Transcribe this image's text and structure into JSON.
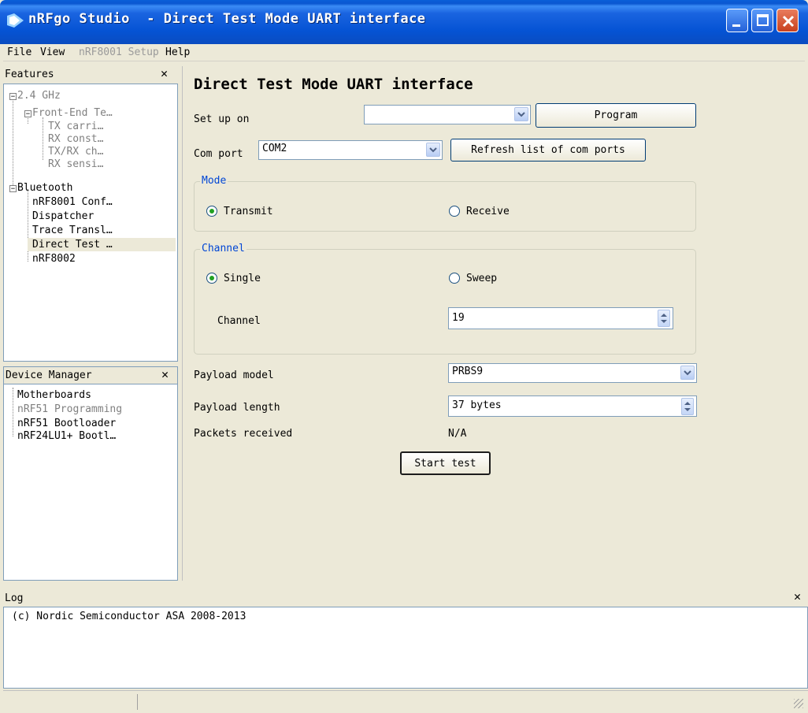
{
  "window": {
    "title": "nRFgo Studio  - Direct Test Mode UART interface"
  },
  "menu": [
    "File",
    "View",
    "nRF8001 Setup",
    "Help"
  ],
  "features_panel": {
    "title": "Features",
    "items": {
      "ghz": "2.4 GHz",
      "frontend": "Front-End Te…",
      "tx_carrier": "TX carri…",
      "rx_const": "RX const…",
      "txrx_ch": "TX/RX ch…",
      "rx_sensi": "RX sensi…",
      "bluetooth": "Bluetooth",
      "nrf8001_conf": "nRF8001 Conf…",
      "dispatcher": "Dispatcher",
      "trace_transl": "Trace Transl…",
      "direct_test": "Direct Test …",
      "nrf8002": "nRF8002"
    }
  },
  "device_manager": {
    "title": "Device Manager",
    "items": {
      "motherboards": "Motherboards",
      "nrf51_prog": "nRF51 Programming",
      "nrf51_boot": "nRF51 Bootloader",
      "nrf24lu1": "nRF24LU1+ Bootl…"
    }
  },
  "main": {
    "heading": "Direct Test Mode UART interface",
    "setup_label": "Set up on",
    "setup_value": "",
    "program_button": "Program",
    "com_label": "Com port",
    "com_value": "COM2",
    "refresh_button": "Refresh list of com ports",
    "mode_group": "Mode",
    "transmit": "Transmit",
    "receive": "Receive",
    "mode_selected": "Transmit",
    "channel_group": "Channel",
    "single": "Single",
    "sweep": "Sweep",
    "channel_mode_selected": "Single",
    "channel_label": "Channel",
    "channel_value": "19",
    "payload_model_label": "Payload model",
    "payload_model_value": "PRBS9",
    "payload_length_label": "Payload length",
    "payload_length_value": "37 bytes",
    "packets_label": "Packets received",
    "packets_value": "N/A",
    "start_button": "Start test"
  },
  "log": {
    "title": "Log",
    "lines": [
      "(c) Nordic Semiconductor ASA 2008-2013"
    ]
  },
  "icons": {
    "close": "close-icon",
    "dropdown": "chevron-down-icon",
    "spinner": "spinner-arrows-icon",
    "app": "nordic-logo-icon"
  }
}
